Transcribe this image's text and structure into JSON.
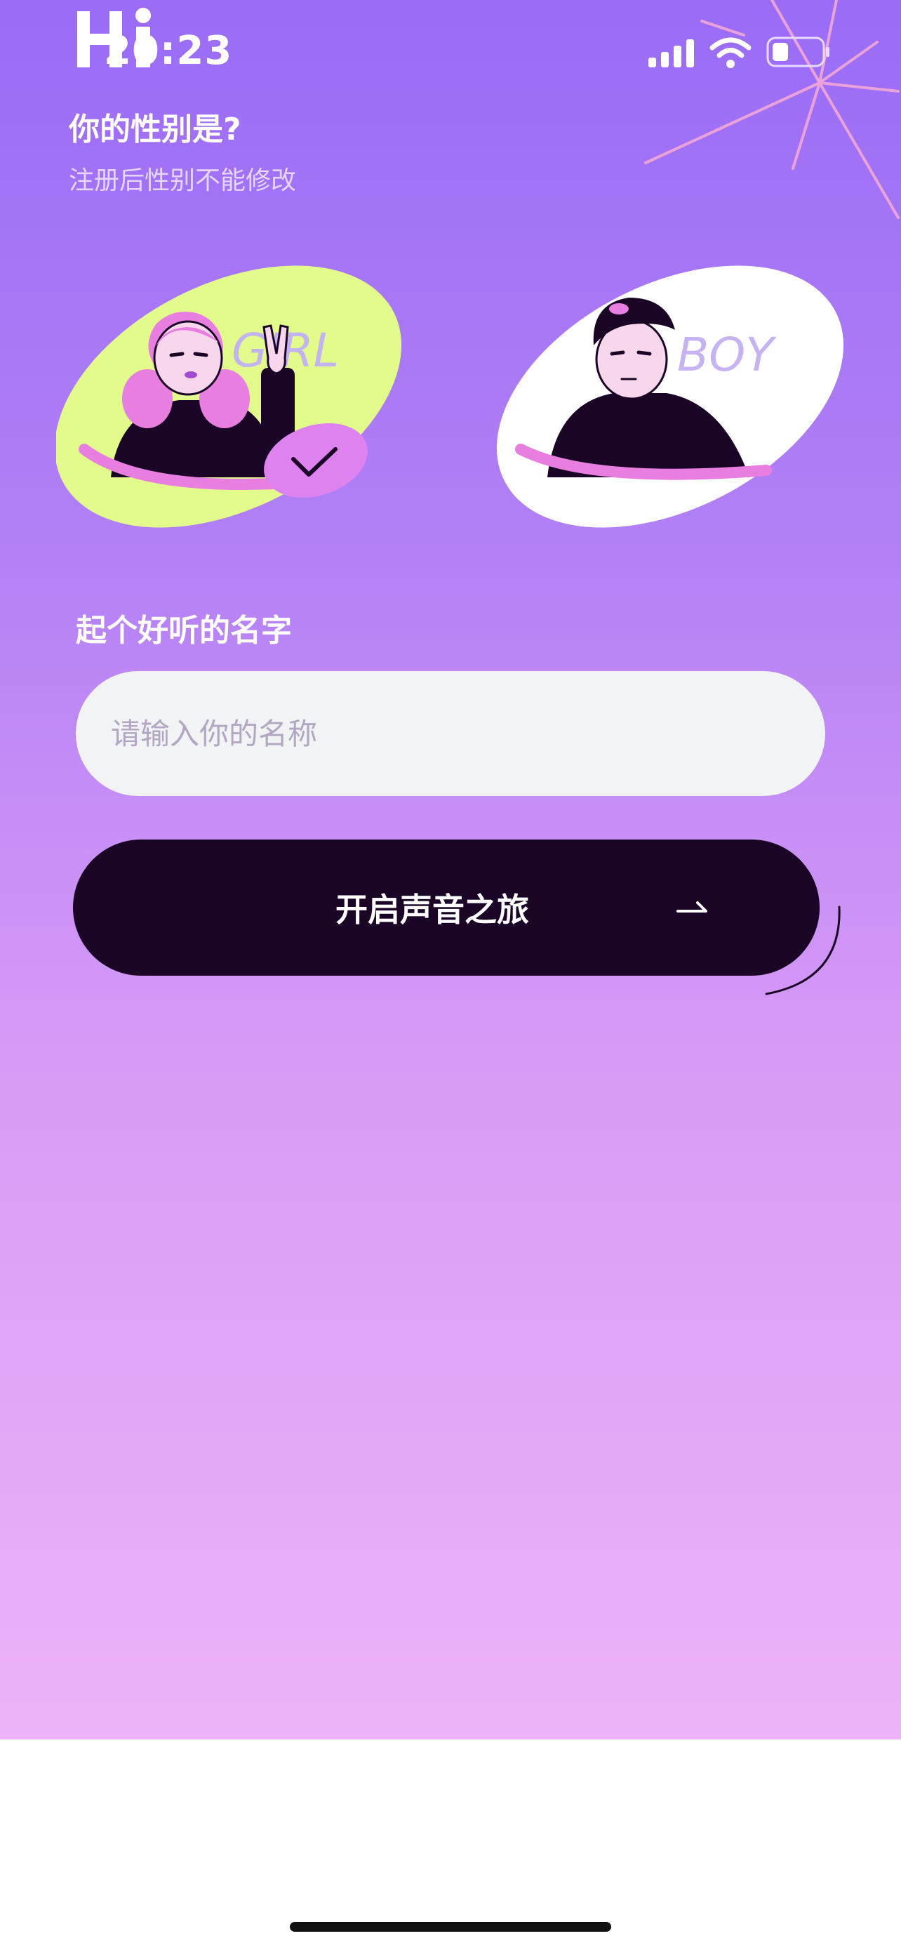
{
  "status_bar": {
    "time": "20:23",
    "signal_icon": "cellular-signal-icon",
    "wifi_icon": "wifi-icon",
    "battery_icon": "battery-icon"
  },
  "brand": {
    "logo_text": "Hi"
  },
  "gender_section": {
    "title": "你的性别是?",
    "subtitle": "注册后性别不能修改",
    "options": [
      {
        "key": "girl",
        "label": "GIRL",
        "selected": true,
        "bg_color": "#e3fb8d"
      },
      {
        "key": "boy",
        "label": "BOY",
        "selected": false,
        "bg_color": "#ffffff"
      }
    ],
    "check_icon": "checkmark-icon",
    "selected_badge_color": "#de82f0"
  },
  "name_section": {
    "label": "起个好听的名字",
    "input_value": "",
    "placeholder": "请输入你的名称"
  },
  "start_button": {
    "label": "开启声音之旅",
    "icon": "arrow-right-icon",
    "color": "#1a0527"
  },
  "colors": {
    "gradient_top": "#9a6cf6",
    "gradient_bottom": "#eeb2f8",
    "accent_pink": "#e87fe0"
  }
}
